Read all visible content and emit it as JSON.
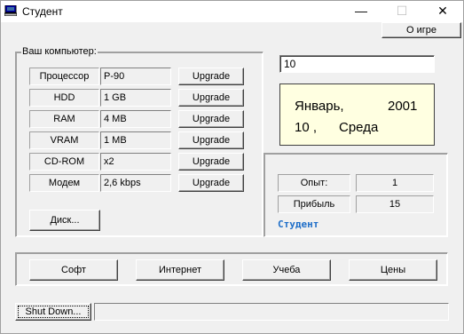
{
  "window": {
    "title": "Студент",
    "minimize_glyph": "—",
    "maximize_glyph": "☐",
    "close_glyph": "✕"
  },
  "about_button": "О игре",
  "computer": {
    "caption": "Ваш компьютер:",
    "upgrade_label": "Upgrade",
    "rows": [
      {
        "label": "Процессор",
        "value": "P-90"
      },
      {
        "label": "HDD",
        "value": "1 GB"
      },
      {
        "label": "RAM",
        "value": "4 MB"
      },
      {
        "label": "VRAM",
        "value": "1 MB"
      },
      {
        "label": "CD-ROM",
        "value": "x2"
      },
      {
        "label": "Модем",
        "value": "2,6 kbps"
      }
    ],
    "disk_button": "Диск..."
  },
  "day_input": "10",
  "date": {
    "month": "Январь,",
    "year": "2001",
    "day": "10 ,",
    "weekday": "Среда"
  },
  "stats": {
    "experience_label": "Опыт:",
    "experience_value": "1",
    "income_label": "Прибыль",
    "income_value": "15",
    "status_text": "Студент"
  },
  "actions": [
    "Софт",
    "Интернет",
    "Учеба",
    "Цены"
  ],
  "shutdown_button": "Shut Down...",
  "status_bar_text": "",
  "colors": {
    "date_background": "#ffffe1",
    "status_link": "#1e6ec8",
    "window_background": "#f0f0f0"
  }
}
